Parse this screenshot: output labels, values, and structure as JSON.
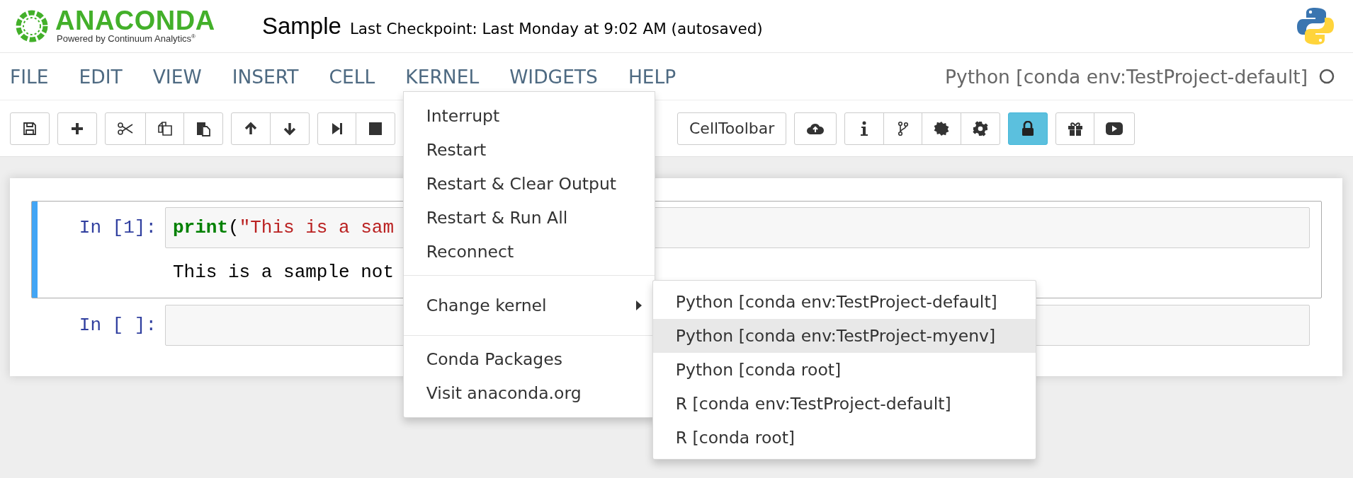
{
  "header": {
    "logo": {
      "name": "ANACONDA",
      "tagline": "Powered by Continuum Analytics$^{®}$"
    },
    "notebook_name": "Sample",
    "checkpoint": "Last Checkpoint: Last Monday at 9:02 AM (autosaved)"
  },
  "menubar": {
    "items": [
      {
        "label": "FILE"
      },
      {
        "label": "EDIT"
      },
      {
        "label": "VIEW"
      },
      {
        "label": "INSERT"
      },
      {
        "label": "CELL"
      },
      {
        "label": "KERNEL",
        "menu": [
          {
            "kind": "item",
            "label": "Interrupt"
          },
          {
            "kind": "item",
            "label": "Restart"
          },
          {
            "kind": "item",
            "label": "Restart & Clear Output"
          },
          {
            "kind": "item",
            "label": "Restart & Run All"
          },
          {
            "kind": "item",
            "label": "Reconnect"
          },
          {
            "kind": "divider"
          },
          {
            "kind": "submenu",
            "label": "Change kernel",
            "submenu": [
              {
                "label": "Python [conda env:TestProject-default]",
                "selected": false
              },
              {
                "label": "Python [conda env:TestProject-myenv]",
                "selected": true
              },
              {
                "label": "Python [conda root]",
                "selected": false
              },
              {
                "label": "R [conda env:TestProject-default]",
                "selected": false
              },
              {
                "label": "R [conda root]",
                "selected": false
              }
            ]
          },
          {
            "kind": "divider"
          },
          {
            "kind": "item",
            "label": "Conda Packages"
          },
          {
            "kind": "item",
            "label": "Visit anaconda.org"
          }
        ]
      },
      {
        "label": "WIDGETS"
      },
      {
        "label": "HELP"
      }
    ],
    "kernel_name": "Python [conda env:TestProject-default]"
  },
  "toolbar": {
    "groups": [
      [
        {
          "kind": "save",
          "active": false
        }
      ],
      [
        {
          "kind": "insert",
          "active": false
        }
      ],
      [
        {
          "kind": "cut",
          "active": false
        },
        {
          "kind": "copy",
          "active": false
        },
        {
          "kind": "paste",
          "active": false
        }
      ],
      [
        {
          "kind": "up",
          "active": false
        },
        {
          "kind": "down",
          "active": false
        }
      ],
      [
        {
          "kind": "step",
          "active": false
        },
        {
          "kind": "stop",
          "active": false
        }
      ],
      [
        {
          "kind": "text",
          "label": "CellToolbar",
          "active": false
        }
      ],
      [
        {
          "kind": "upload",
          "active": false
        }
      ],
      [
        {
          "kind": "info",
          "active": false
        },
        {
          "kind": "branch",
          "active": false
        },
        {
          "kind": "badge",
          "active": false
        },
        {
          "kind": "gear",
          "active": false
        }
      ],
      [
        {
          "kind": "lock",
          "active": true
        }
      ],
      [
        {
          "kind": "gift",
          "active": false
        },
        {
          "kind": "play",
          "active": false
        }
      ]
    ]
  },
  "cells": [
    {
      "prompt": "In [1]:",
      "selected": true,
      "code": [
        {
          "kind": "builtin",
          "text": "print"
        },
        {
          "kind": "punct",
          "text": "("
        },
        {
          "kind": "string",
          "text": "\"This is a sam"
        }
      ],
      "output": "This is a sample not"
    },
    {
      "prompt": "In [ ]:",
      "selected": false
    }
  ]
}
